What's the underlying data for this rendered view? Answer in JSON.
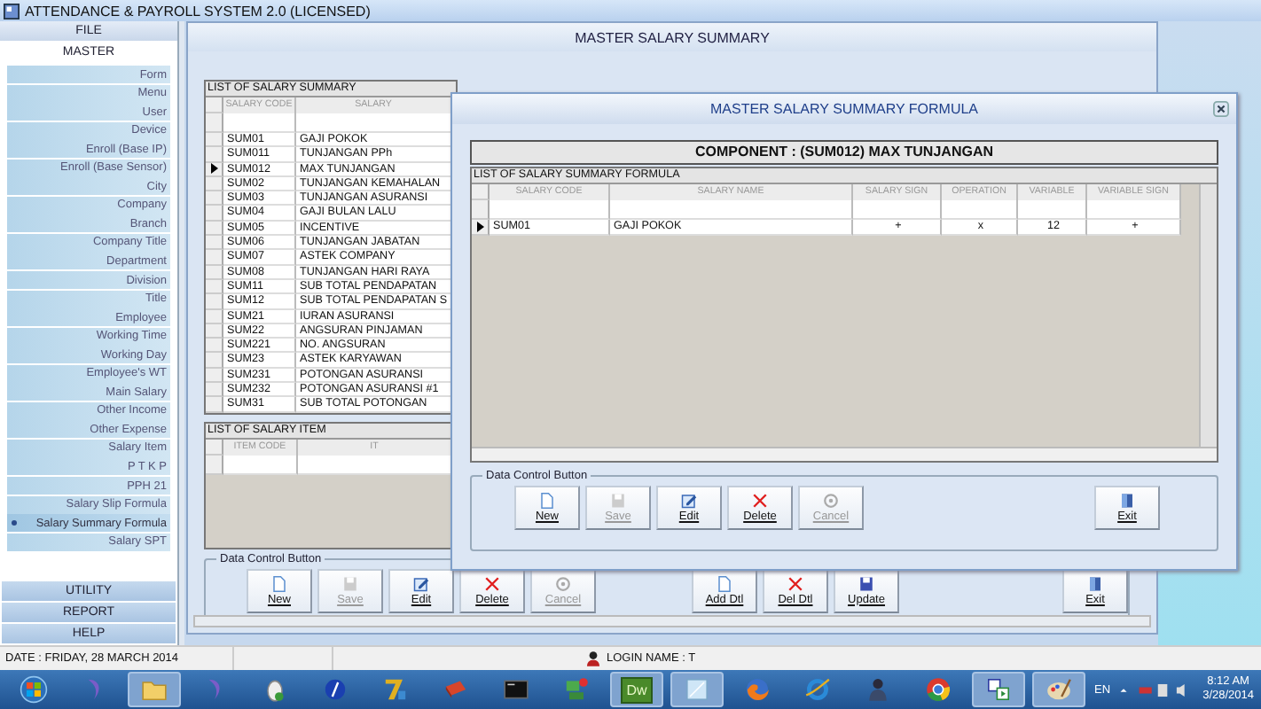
{
  "app": {
    "title": "ATTENDANCE & PAYROLL SYSTEM 2.0 (LICENSED)"
  },
  "sidebar": {
    "file": "FILE",
    "master": "MASTER",
    "items": [
      {
        "label": "Form",
        "selected": false
      },
      {
        "label": "Menu",
        "selected": false
      },
      {
        "label": "User",
        "selected": false
      },
      {
        "label": "Device",
        "selected": false
      },
      {
        "label": "Enroll (Base IP)",
        "selected": false
      },
      {
        "label": "Enroll (Base Sensor)",
        "selected": false
      },
      {
        "label": "City",
        "selected": false
      },
      {
        "label": "Company",
        "selected": false
      },
      {
        "label": "Branch",
        "selected": false
      },
      {
        "label": "Company Title",
        "selected": false
      },
      {
        "label": "Department",
        "selected": false
      },
      {
        "label": "Division",
        "selected": false
      },
      {
        "label": "Title",
        "selected": false
      },
      {
        "label": "Employee",
        "selected": false
      },
      {
        "label": "Working Time",
        "selected": false
      },
      {
        "label": "Working Day",
        "selected": false
      },
      {
        "label": "Employee's WT",
        "selected": false
      },
      {
        "label": "Main Salary",
        "selected": false
      },
      {
        "label": "Other Income",
        "selected": false
      },
      {
        "label": "Other Expense",
        "selected": false
      },
      {
        "label": "Salary Item",
        "selected": false
      },
      {
        "label": "P T K P",
        "selected": false
      },
      {
        "label": "PPH 21",
        "selected": false
      },
      {
        "label": "Salary Slip Formula",
        "selected": false
      },
      {
        "label": "Salary Summary Formula",
        "selected": true
      },
      {
        "label": "Salary SPT",
        "selected": false
      }
    ],
    "sections": [
      "UTILITY",
      "REPORT",
      "HELP"
    ]
  },
  "master_window": {
    "title": "MASTER SALARY SUMMARY",
    "summary_list": {
      "caption": "LIST OF SALARY SUMMARY",
      "columns": [
        "SALARY CODE",
        "SALARY"
      ],
      "rows": [
        {
          "code": "SUM01",
          "name": "GAJI POKOK",
          "selected": false
        },
        {
          "code": "SUM011",
          "name": "TUNJANGAN PPh",
          "selected": false
        },
        {
          "code": "SUM012",
          "name": "MAX TUNJANGAN",
          "selected": true
        },
        {
          "code": "SUM02",
          "name": "TUNJANGAN KEMAHALAN",
          "selected": false
        },
        {
          "code": "SUM03",
          "name": "TUNJANGAN ASURANSI",
          "selected": false
        },
        {
          "code": "SUM04",
          "name": "GAJI BULAN LALU",
          "selected": false
        },
        {
          "code": "SUM05",
          "name": "INCENTIVE",
          "selected": false
        },
        {
          "code": "SUM06",
          "name": "TUNJANGAN JABATAN",
          "selected": false
        },
        {
          "code": "SUM07",
          "name": "ASTEK COMPANY",
          "selected": false
        },
        {
          "code": "SUM08",
          "name": "TUNJANGAN HARI RAYA",
          "selected": false
        },
        {
          "code": "SUM11",
          "name": "SUB TOTAL PENDAPATAN",
          "selected": false
        },
        {
          "code": "SUM12",
          "name": "SUB TOTAL PENDAPATAN S",
          "selected": false
        },
        {
          "code": "SUM21",
          "name": "IURAN ASURANSI",
          "selected": false
        },
        {
          "code": "SUM22",
          "name": "ANGSURAN PINJAMAN",
          "selected": false
        },
        {
          "code": "SUM221",
          "name": "NO. ANGSURAN",
          "selected": false
        },
        {
          "code": "SUM23",
          "name": "ASTEK KARYAWAN",
          "selected": false
        },
        {
          "code": "SUM231",
          "name": "POTONGAN ASURANSI",
          "selected": false
        },
        {
          "code": "SUM232",
          "name": "POTONGAN ASURANSI #1",
          "selected": false
        },
        {
          "code": "SUM31",
          "name": "SUB TOTAL POTONGAN",
          "selected": false
        }
      ]
    },
    "item_list": {
      "caption": "LIST OF SALARY ITEM",
      "columns": [
        "ITEM CODE",
        "IT"
      ]
    },
    "group_label": "Data Control Button",
    "buttons": [
      {
        "label": "New",
        "kind": "new",
        "disabled": false
      },
      {
        "label": "Save",
        "kind": "save",
        "disabled": true
      },
      {
        "label": "Edit",
        "kind": "edit",
        "disabled": false
      },
      {
        "label": "Delete",
        "kind": "delete",
        "disabled": false
      },
      {
        "label": "Cancel",
        "kind": "cancel",
        "disabled": true
      },
      {
        "label": "Add Dtl",
        "kind": "new",
        "disabled": false
      },
      {
        "label": "Del Dtl",
        "kind": "delete",
        "disabled": false
      },
      {
        "label": "Update",
        "kind": "save",
        "disabled": false
      },
      {
        "label": "Exit",
        "kind": "exit",
        "disabled": false
      }
    ]
  },
  "formula_window": {
    "title": "MASTER SALARY SUMMARY FORMULA",
    "component": "COMPONENT : (SUM012) MAX TUNJANGAN",
    "list": {
      "caption": "LIST OF SALARY SUMMARY FORMULA",
      "columns": [
        "SALARY CODE",
        "SALARY NAME",
        "SALARY SIGN",
        "OPERATION",
        "VARIABLE",
        "VARIABLE SIGN"
      ],
      "rows": [
        {
          "cells": [
            "SUM01",
            "GAJI POKOK",
            "+",
            "x",
            "12",
            "+"
          ],
          "selected": true
        }
      ]
    },
    "group_label": "Data Control Button",
    "buttons": [
      {
        "label": "New",
        "kind": "new",
        "disabled": false
      },
      {
        "label": "Save",
        "kind": "save",
        "disabled": true
      },
      {
        "label": "Edit",
        "kind": "edit",
        "disabled": false
      },
      {
        "label": "Delete",
        "kind": "delete",
        "disabled": false
      },
      {
        "label": "Cancel",
        "kind": "cancel",
        "disabled": true
      },
      {
        "label": "Exit",
        "kind": "exit",
        "disabled": false
      }
    ]
  },
  "status_bar": {
    "date": "DATE : FRIDAY, 28 MARCH 2014",
    "login": "LOGIN NAME  : T"
  },
  "taskbar": {
    "items": [
      {
        "kind": "start",
        "active": false
      },
      {
        "kind": "swirl",
        "active": false
      },
      {
        "kind": "folder",
        "active": true
      },
      {
        "kind": "swirl",
        "active": false
      },
      {
        "kind": "mouse",
        "active": false
      },
      {
        "kind": "disc",
        "active": false
      },
      {
        "kind": "zip",
        "active": false
      },
      {
        "kind": "book",
        "active": false
      },
      {
        "kind": "terminal",
        "active": false
      },
      {
        "kind": "network",
        "active": false
      },
      {
        "kind": "dw",
        "label": "Dw",
        "active": true
      },
      {
        "kind": "window",
        "active": true
      },
      {
        "kind": "firefox",
        "active": false
      },
      {
        "kind": "ie",
        "active": false
      },
      {
        "kind": "figure",
        "active": false
      },
      {
        "kind": "chrome",
        "active": false
      },
      {
        "kind": "remote",
        "active": true
      },
      {
        "kind": "paint",
        "active": true
      }
    ],
    "language": "EN",
    "time": "8:12 AM",
    "date": "3/28/2014"
  }
}
